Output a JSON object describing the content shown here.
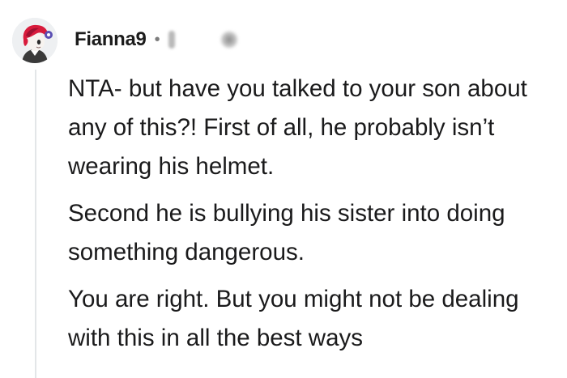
{
  "comment": {
    "author": "Fianna9",
    "separator": "•",
    "paragraphs": [
      "NTA- but have you talked to your son about any of this?! First of all, he probably isn’t wearing his helmet.",
      "Second he is bullying his sister into doing something dangerous.",
      "You are right. But you might not be dealing with this in all the best ways"
    ]
  },
  "colors": {
    "text": "#1a1a1b",
    "meta": "#7c7c7c",
    "thread_line": "#e3e6e8",
    "avatar_hair": "#d81b3c"
  }
}
